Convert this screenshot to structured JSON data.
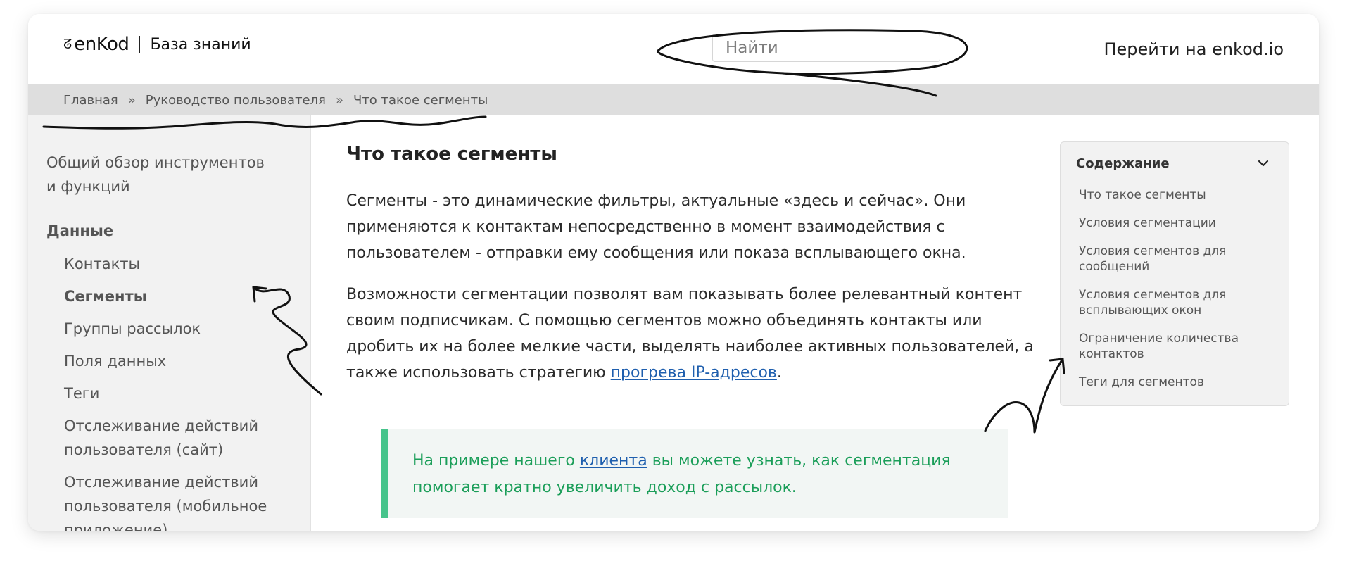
{
  "header": {
    "logo_mark": "ᘔ",
    "logo_text": "enKod",
    "site_name": "База знаний",
    "search_placeholder": "Найти",
    "search_value": "",
    "goto_label": "Перейти на enkod.io"
  },
  "breadcrumb": {
    "items": [
      "Главная",
      "Руководство пользователя",
      "Что такое сегменты"
    ],
    "separator": "»"
  },
  "sidebar": {
    "top_item": "Общий обзор инструментов и функций",
    "section": "Данные",
    "items": [
      "Контакты",
      "Сегменты",
      "Группы рассылок",
      "Поля данных",
      "Теги",
      "Отслеживание действий пользователя (сайт)",
      "Отслеживание действий пользователя (мобильное приложение)"
    ],
    "active_index": 1
  },
  "article": {
    "title": "Что такое сегменты",
    "p1": "Сегменты - это динамические фильтры, актуальные «здесь и сейчас». Они применяются к контактам непосредственно в момент взаимодействия с пользователем - отправки ему сообщения или показа всплывающего окна.",
    "p2_before": "Возможности сегментации позволят вам показывать более релевантный контент своим подписчикам. С помощью сегментов можно объединять контакты или дробить их на более мелкие части, выделять наиболее активных пользователей, а также использовать стратегию ",
    "p2_link": "прогрева IP-адресов",
    "p2_after": ".",
    "note_before": "На примере нашего ",
    "note_link": "клиента",
    "note_after": " вы можете узнать, как сегментация помогает кратно увеличить доход с рассылок."
  },
  "toc": {
    "title": "Содержание",
    "items": [
      "Что такое сегменты",
      "Условия сегментации",
      "Условия сегментов для сообщений",
      "Условия сегментов для всплывающих окон",
      "Ограничение количества контактов",
      "Теги для сегментов"
    ]
  },
  "colors": {
    "breadcrumb_bg": "#dedede",
    "sidebar_bg": "#f2f2f2",
    "note_accent": "#46c48b",
    "note_text": "#1b9e59",
    "link": "#1f5fae"
  }
}
